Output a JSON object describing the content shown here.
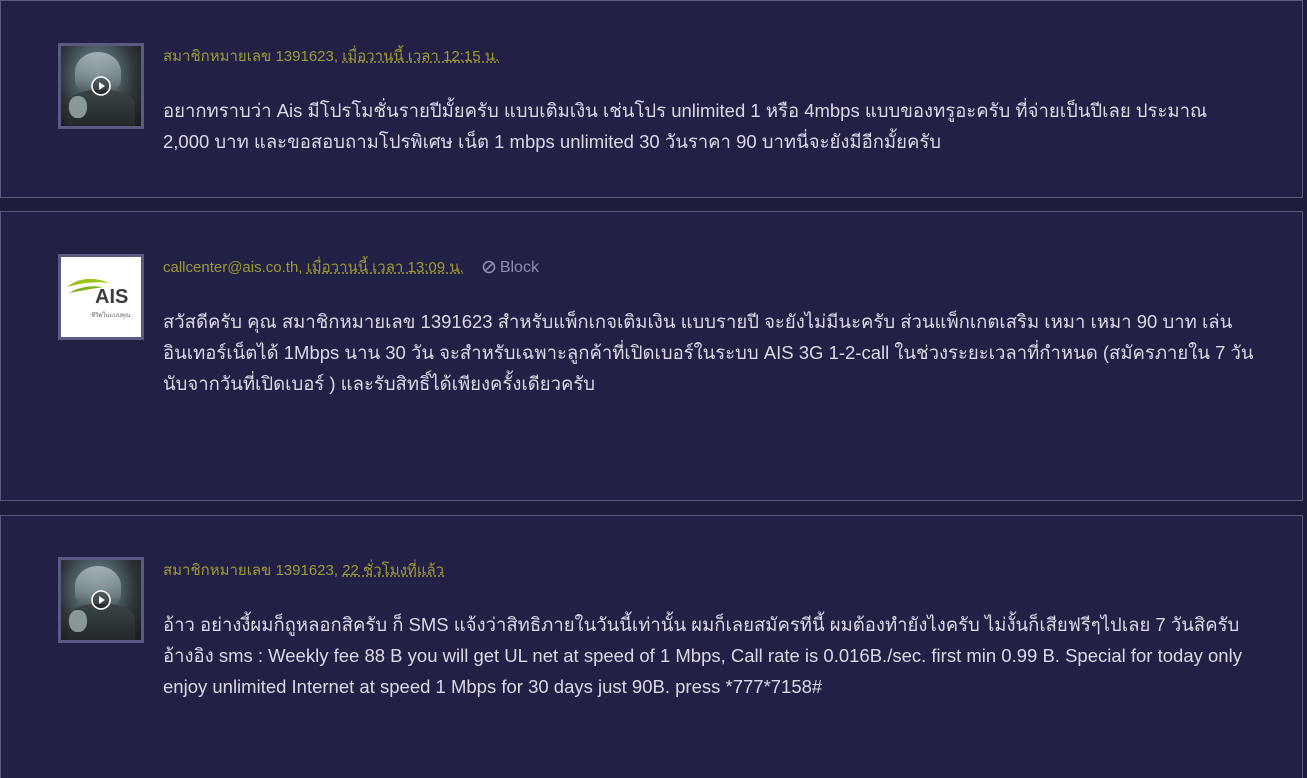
{
  "posts": [
    {
      "author": "สมาชิกหมายเลข 1391623",
      "time": "เมื่อวานนี้ เวลา 12:15 น.",
      "avatar": "anime-avatar",
      "text": "อยากทราบว่า Ais มีโปรโมชั่นรายปีมั้ยครับ แบบเติมเงิน เช่นโปร unlimited 1 หรือ 4mbps แบบของทรูอะครับ ที่จ่ายเป็นปีเลย ประมาณ 2,000 บาท และขอสอบถามโปรพิเศษ เน็ต 1 mbps unlimited 30 วันราคา 90 บาทนี่จะยังมีอีกมั้ยครับ"
    },
    {
      "author": "callcenter@ais.co.th",
      "time": "เมื่อวานนี้ เวลา 13:09 น.",
      "block_label": "Block",
      "avatar": "ais-logo",
      "logo_text": "AIS",
      "logo_tagline": "ชีวิตในแบบคุณ",
      "text": "สวัสดีครับ คุณ สมาชิกหมายเลข 1391623 สำหรับแพ็กเกจเติมเงิน แบบรายปี จะยังไม่มีนะครับ ส่วนแพ็กเกตเสริม เหมา เหมา 90 บาท เล่นอินเทอร์เน็ตได้ 1Mbps นาน 30 วัน จะสำหรับเฉพาะลูกค้าที่เปิดเบอร์ในระบบ AIS 3G 1-2-call  ในช่วงระยะเวลาที่กำหนด (สมัครภายใน 7 วัน นับจากวันที่เปิดเบอร์ ) และรับสิทธิ์ได้เพียงครั้งเดียวครับ"
    },
    {
      "author": "สมาชิกหมายเลข 1391623",
      "time": "22 ชั่วโมงที่แล้ว",
      "avatar": "anime-avatar",
      "text": "อ้าว อย่างงี้ผมก็ถูหลอกสิครับ ก็ SMS แจ้งว่าสิทธิภายในวันนี้เท่านั้น ผมก็เลยสมัครทีนี้ ผมต้องทำยังไงครับ ไม่งั้นก็เสียฟรีๆไปเลย 7 วันสิครับ",
      "text2": "อ้างอิง sms : Weekly fee 88 B you will get UL net at speed of 1 Mbps, Call rate is 0.016B./sec. first min 0.99 B. Special for today only enjoy unlimited Internet at speed 1 Mbps for 30 days just 90B. press *777*7158#"
    }
  ],
  "colors": {
    "page_bg": "#1d1c3b",
    "card_bg": "#222145",
    "author": "#9c9a35",
    "text": "#d9d9e6",
    "block": "#8d8cb8"
  }
}
